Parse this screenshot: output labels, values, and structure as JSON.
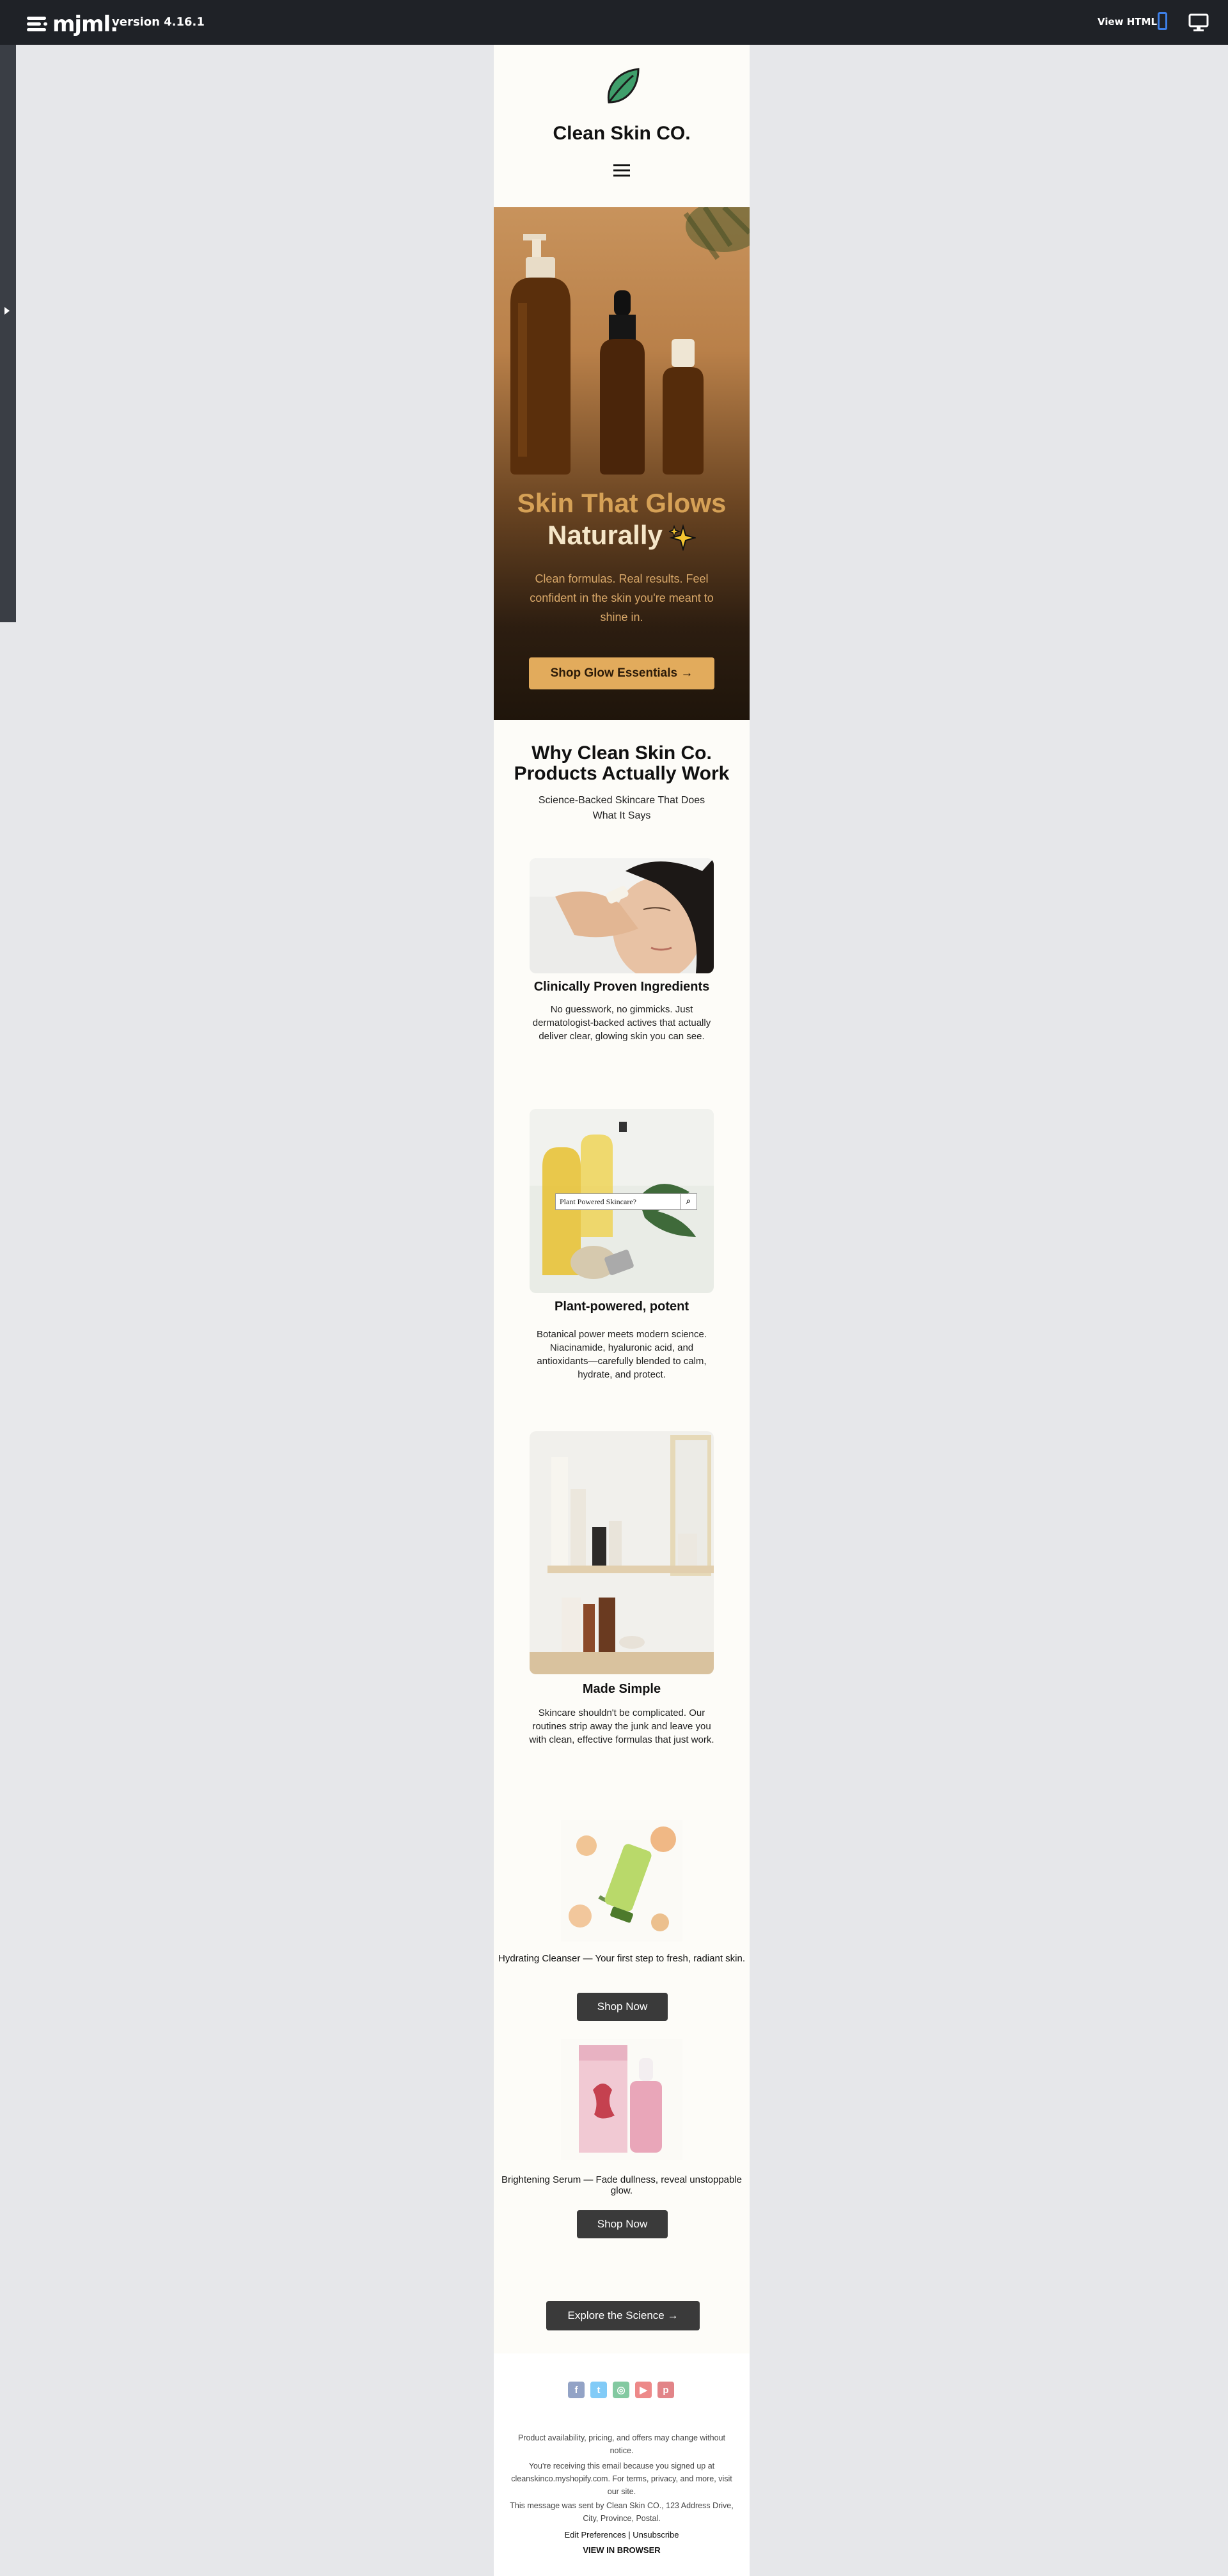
{
  "editor": {
    "logo": "mjml.",
    "version": "version 4.16.1",
    "view_html": "View HTML",
    "icons": [
      "mjml-logo-icon",
      "mobile-preview-icon",
      "desktop-preview-icon",
      "expand-panel-icon"
    ],
    "accent": "#3d7fe6"
  },
  "email": {
    "brand": "Clean Skin CO.",
    "icons": [
      "leaf-icon",
      "hamburger-menu-icon"
    ],
    "hero": {
      "title_line1": "Skin That Glows",
      "title_line2": "Naturally",
      "subtitle": "Clean formulas. Real results. Feel confident in the skin you're meant to shine in.",
      "cta": "Shop Glow Essentials →",
      "colors": {
        "title": "#d6a156",
        "cta_bg": "#e2ab5c"
      }
    },
    "why": {
      "title": "Why Clean Skin Co. Products Actually Work",
      "subtitle": "Science-Backed Skincare That Does What It Says"
    },
    "features": [
      {
        "title": "Clinically Proven Ingredients",
        "text": "No guesswork, no gimmicks. Just dermatologist-backed actives that actually deliver clear, glowing skin you can see."
      },
      {
        "title": "Plant-powered, potent",
        "text": "Botanical power meets modern science. Niacinamide, hyaluronic acid, and antioxidants—carefully blended to calm, hydrate, and protect.",
        "image_overlay_search": "Plant Powered Skincare?"
      },
      {
        "title": "Made Simple",
        "text": "Skincare shouldn't be complicated. Our routines strip away the junk and leave you with clean, effective formulas that just work."
      }
    ],
    "products": [
      {
        "caption": "Hydrating Cleanser — Your first step to fresh, radiant skin.",
        "button": "Shop Now"
      },
      {
        "caption": "Brightening Serum — Fade dullness, reveal unstoppable glow.",
        "button": "Shop Now"
      }
    ],
    "explore_button": "Explore the Science →",
    "footer": {
      "social_icons": [
        "facebook-icon",
        "twitter-icon",
        "instagram-icon",
        "youtube-icon",
        "pinterest-icon"
      ],
      "disclaimer": "Product availability, pricing, and offers may change without notice.",
      "signup_note": "You're receiving this email because you signed up at cleanskinco.myshopify.com. For terms, privacy, and more, visit our site.",
      "sender": "This message was sent by Clean Skin CO., 123 Address Drive, City, Province, Postal.",
      "edit_preferences": "Edit Preferences",
      "separator": "|",
      "unsubscribe": "Unsubscribe",
      "view_in_browser": "VIEW IN BROWSER"
    }
  }
}
